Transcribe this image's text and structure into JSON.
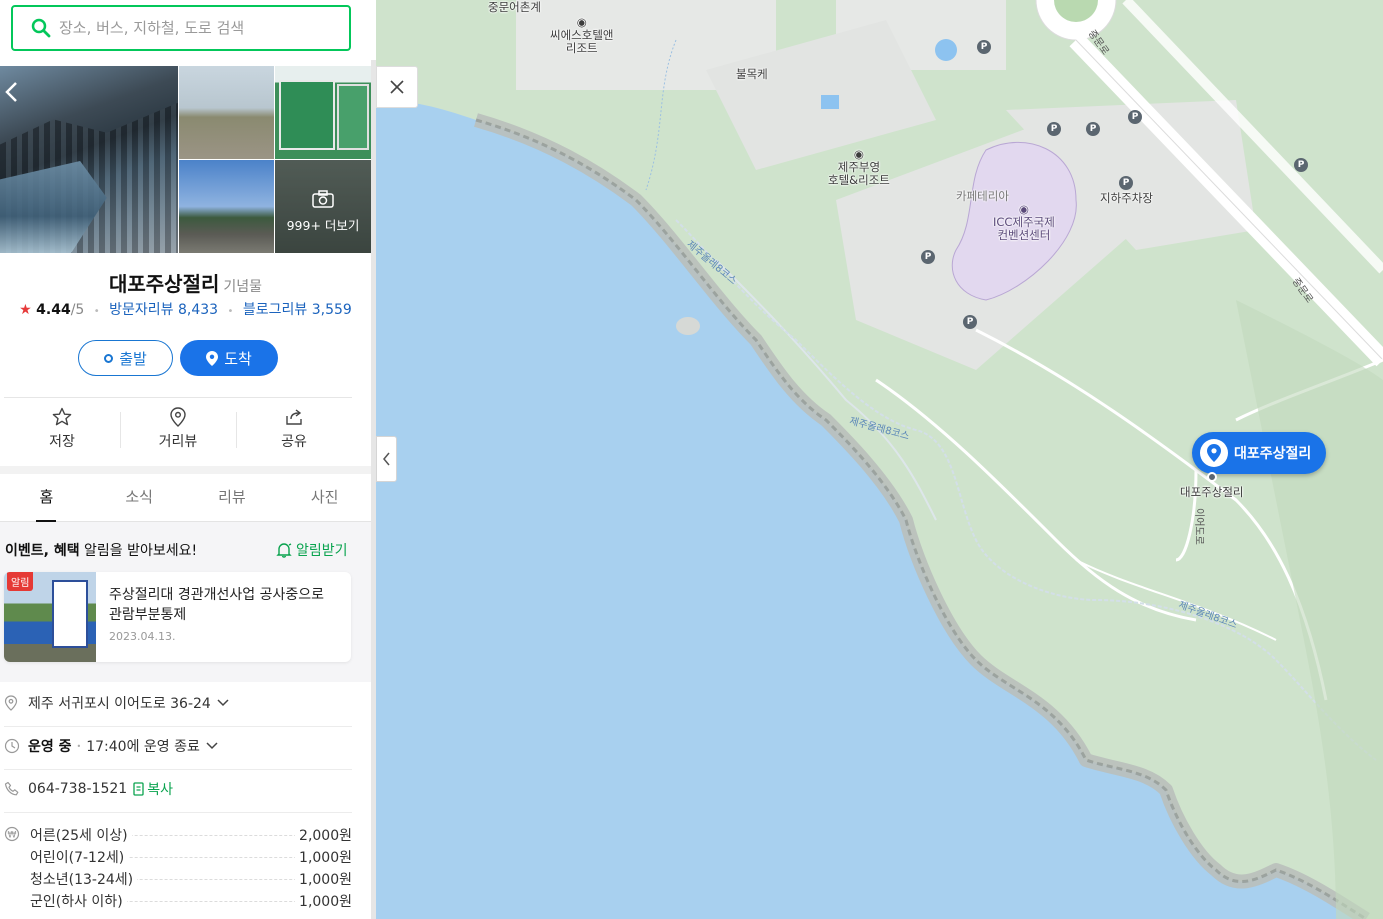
{
  "search": {
    "placeholder": "장소, 버스, 지하철, 도로 검색"
  },
  "photos": {
    "more_label": "999+ 더보기"
  },
  "place": {
    "name": "대포주상절리",
    "category": "기념물",
    "rating": "4.44",
    "rating_max": "/5",
    "visitor_reviews": "방문자리뷰 8,433",
    "blog_reviews": "블로그리뷰 3,559"
  },
  "route_buttons": {
    "departure": "출발",
    "arrival": "도착"
  },
  "actions": [
    {
      "label": "저장",
      "icon": "star-icon"
    },
    {
      "label": "거리뷰",
      "icon": "location-pin-icon"
    },
    {
      "label": "공유",
      "icon": "share-icon"
    }
  ],
  "tabs": [
    "홈",
    "소식",
    "리뷰",
    "사진"
  ],
  "event_banner": {
    "bold": "이벤트, 혜택",
    "rest": " 알림을 받아보세요!",
    "notify_label": "알림받기"
  },
  "notice": {
    "badge": "알림",
    "text": "주상절리대 경관개선사업 공사중으로 관람부분통제",
    "date": "2023.04.13."
  },
  "info": {
    "address": "제주 서귀포시 이어도로 36-24",
    "status": "운영 중",
    "hours": "17:40에 운영 종료",
    "phone": "064-738-1521",
    "copy_label": "복사"
  },
  "fees": [
    {
      "label": "어른(25세 이상)",
      "value": "2,000원"
    },
    {
      "label": "어린이(7-12세)",
      "value": "1,000원"
    },
    {
      "label": "청소년(13-24세)",
      "value": "1,000원"
    },
    {
      "label": "군인(하사 이하)",
      "value": "1,000원"
    }
  ],
  "map": {
    "labels": {
      "jungmun_village": "중문어촌계",
      "shilla_top": "씨에스호텔앤",
      "shilla_bottom": "리조트",
      "bulmokke": "불목케",
      "jeju_buyoung_top": "제주부영",
      "jeju_buyoung_bottom": "호텔&리조트",
      "cafeteria": "카페테리아",
      "icc_top": "ICC제주국제",
      "icc_bottom": "컨벤션센터",
      "underground_parking": "지하주차장",
      "pin_below": "대포주상절리",
      "pin_label": "대포주상절리"
    },
    "roads": {
      "jungmun_ro_1": "중문로",
      "jungmun_ro_2": "중문로",
      "olle_1": "제주올레8코스",
      "olle_2": "제주올레8코스",
      "olle_3": "제주올레8코스",
      "ieodo_ro": "이어도로"
    },
    "parking_symbol": "P"
  },
  "colors": {
    "brand_green": "#03c75a",
    "accent_blue": "#1a73e8",
    "sea": "#a8d0ef",
    "land": "#cfe3cc"
  }
}
